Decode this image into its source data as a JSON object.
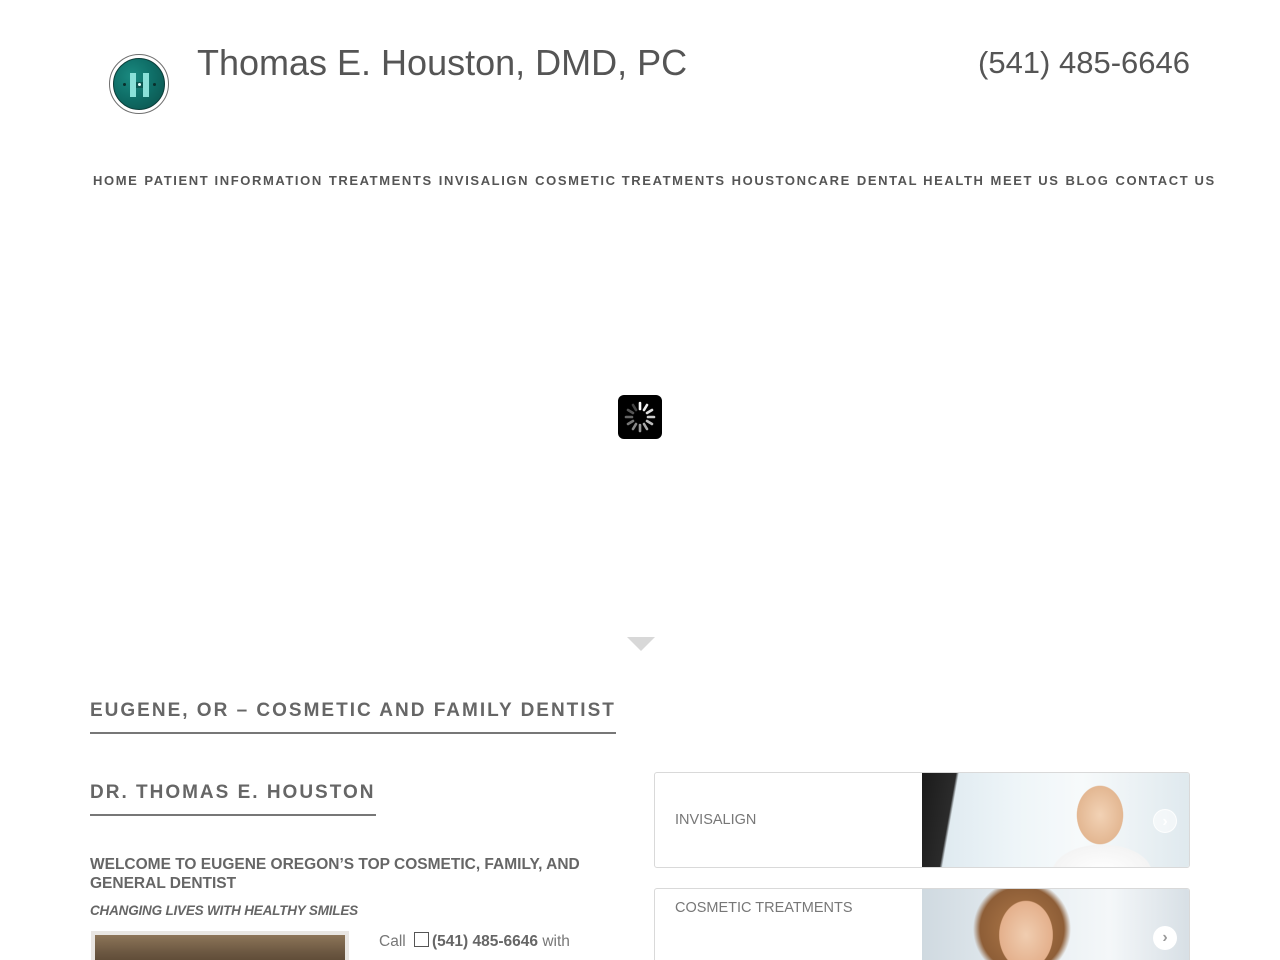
{
  "header": {
    "site_title": "Thomas E. Houston, DMD, PC",
    "phone": "(541) 485-6646",
    "logo_icon": "houston-h-logo"
  },
  "nav": {
    "items": [
      {
        "label": "HOME"
      },
      {
        "label": "PATIENT INFORMATION"
      },
      {
        "label": "TREATMENTS"
      },
      {
        "label": "INVISALIGN"
      },
      {
        "label": "COSMETIC TREATMENTS"
      },
      {
        "label": "HOUSTONCARE"
      },
      {
        "label": "DENTAL HEALTH"
      },
      {
        "label": "MEET US"
      },
      {
        "label": "BLOG"
      },
      {
        "label": "CONTACT US"
      }
    ]
  },
  "hero": {
    "loader_icon": "spinner-icon",
    "scroll_icon": "down-arrow-icon"
  },
  "main": {
    "heading": "EUGENE, OR – COSMETIC AND FAMILY DENTIST",
    "doctor_heading": "DR. THOMAS E. HOUSTON",
    "welcome": "WELCOME TO EUGENE OREGON’S TOP  COSMETIC,  FAMILY, AND GENERAL DENTIST",
    "tagline": "CHANGING LIVES WITH HEALTHY SMILES",
    "call_prefix": "Call",
    "call_phone": "(541) 485-6646",
    "call_suffix": "with"
  },
  "cards": [
    {
      "label": "INVISALIGN",
      "arrow_icon": "chevron-right-circle-icon"
    },
    {
      "label": "COSMETIC TREATMENTS",
      "arrow_icon": "chevron-right-circle-icon"
    }
  ],
  "colors": {
    "text": "#666666",
    "logo_teal": "#0f6f68",
    "loader_bg": "#000000"
  }
}
